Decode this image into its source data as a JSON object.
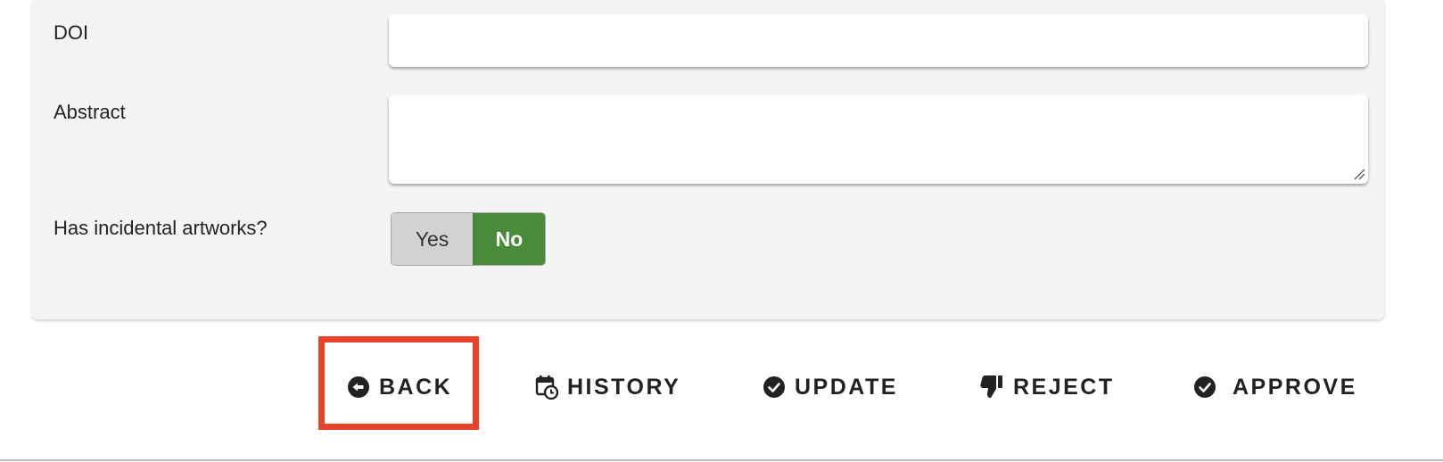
{
  "form": {
    "doi": {
      "label": "DOI",
      "value": ""
    },
    "abstract": {
      "label": "Abstract",
      "value": ""
    },
    "incidental_artworks": {
      "label": "Has incidental artworks?",
      "options": [
        "Yes",
        "No"
      ],
      "selected": "No"
    }
  },
  "actions": {
    "back": {
      "label": "BACK",
      "icon": "arrow-left-circle-icon"
    },
    "history": {
      "label": "HISTORY",
      "icon": "calendar-clock-icon"
    },
    "update": {
      "label": "UPDATE",
      "icon": "check-circle-icon"
    },
    "reject": {
      "label": "REJECT",
      "icon": "thumbs-down-icon"
    },
    "approve": {
      "label": "APPROVE",
      "icon": "check-circle-icon"
    }
  },
  "colors": {
    "panel_bg": "#f4f4f4",
    "toggle_selected": "#4a8a3b",
    "toggle_unselected": "#d2d2d2",
    "highlight": "#e8432a"
  }
}
